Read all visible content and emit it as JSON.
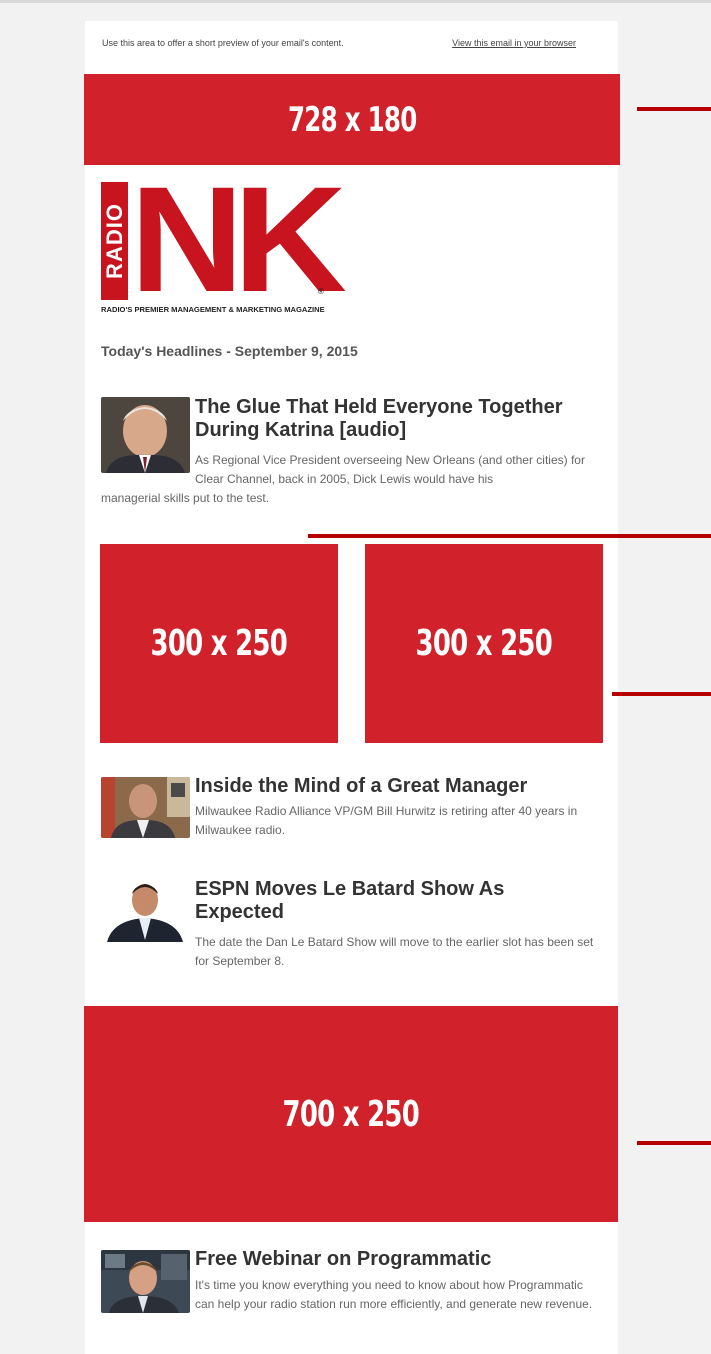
{
  "preheader": {
    "text": "Use this area to offer a short preview of your email's content.",
    "view_link": "View this email in your browser"
  },
  "ads": {
    "leaderboard": "728 x 180",
    "rect_left": "300 x 250",
    "rect_right": "300 x 250",
    "billboard": "700 x 250"
  },
  "logo": {
    "radio": "RADIO",
    "nk": "NK",
    "reg": "®",
    "tagline": "RADIO'S PREMIER MANAGEMENT & MARKETING MAGAZINE"
  },
  "headlines_title": "Today's Headlines - September 9, 2015",
  "articles": [
    {
      "title": "The Glue That Held Everyone Together During Katrina [audio]",
      "body_first": "As Regional Vice President overseeing New Orleans (and other cities) for Clear Channel, back in 2005, Dick Lewis would have his",
      "body_rest": "managerial skills put to the test."
    },
    {
      "title": "Inside the Mind of a Great Manager",
      "body": "Milwaukee Radio Alliance VP/GM Bill Hurwitz is retiring after 40 years in Milwaukee radio."
    },
    {
      "title": "ESPN Moves Le Batard Show As Expected",
      "body": "The date the Dan Le Batard Show will move to the earlier slot has been set for September 8."
    },
    {
      "title": "Free Webinar on Programmatic",
      "body": "It's time you know everything you need to know about how Programmatic can help your radio station run more efficiently, and generate new revenue."
    }
  ],
  "colors": {
    "ad_red": "#d1212a",
    "brand_red": "#c8141e",
    "accent_line": "#b60000"
  }
}
